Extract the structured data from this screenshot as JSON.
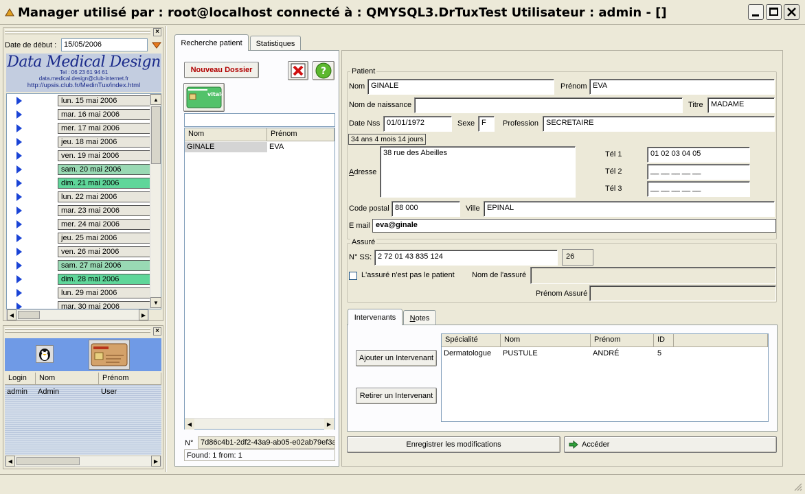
{
  "window": {
    "title": "Manager utilisé par : root@localhost connecté à : QMYSQL3.DrTuxTest Utilisateur : admin - []"
  },
  "agenda": {
    "start_label": "Date de début :",
    "start_date": "15/05/2006",
    "logo_title": "Data Medical Design",
    "logo_tel": "Tel : 06 23 61 94 61",
    "logo_email": "data.medical.design@club-internet.fr",
    "logo_url": "http://upsis.club.fr/MedinTux/index.html",
    "days": [
      {
        "label": "lun. 15 mai 2006",
        "style": "normal"
      },
      {
        "label": "mar. 16 mai 2006",
        "style": "normal"
      },
      {
        "label": "mer. 17 mai 2006",
        "style": "normal"
      },
      {
        "label": "jeu. 18 mai 2006",
        "style": "normal"
      },
      {
        "label": "ven. 19 mai 2006",
        "style": "normal"
      },
      {
        "label": "sam. 20 mai 2006",
        "style": "lightgreen"
      },
      {
        "label": "dim. 21 mai 2006",
        "style": "green"
      },
      {
        "label": "lun. 22 mai 2006",
        "style": "normal"
      },
      {
        "label": "mar. 23 mai 2006",
        "style": "normal"
      },
      {
        "label": "mer. 24 mai 2006",
        "style": "normal"
      },
      {
        "label": "jeu. 25 mai 2006",
        "style": "normal"
      },
      {
        "label": "ven. 26 mai 2006",
        "style": "normal"
      },
      {
        "label": "sam. 27 mai 2006",
        "style": "lightgreen"
      },
      {
        "label": "dim. 28 mai 2006",
        "style": "green"
      },
      {
        "label": "lun. 29 mai 2006",
        "style": "normal"
      },
      {
        "label": "mar. 30 mai 2006",
        "style": "normal"
      }
    ]
  },
  "users": {
    "headers": [
      "Login",
      "Nom",
      "Prénom"
    ],
    "rows": [
      [
        "admin",
        "Admin",
        "User"
      ]
    ]
  },
  "search": {
    "tabs": [
      "Recherche patient",
      "Statistiques"
    ],
    "new_file": "Nouveau Dossier",
    "list_headers": [
      "Nom",
      "Prénom"
    ],
    "rows": [
      [
        "GINALE",
        "EVA"
      ]
    ],
    "id_label": "N°",
    "id_value": "7d86c4b1-2df2-43a9-ab05-e02ab79ef3a",
    "found": "Found: 1 from: 1"
  },
  "patient": {
    "group": "Patient",
    "nom_label": "Nom",
    "nom": "GINALE",
    "prenom_label": "Prénom",
    "prenom": "EVA",
    "naissance_label": "Nom de naissance",
    "naissance": "",
    "titre_label": "Titre",
    "titre": "MADAME",
    "dnss_label": "Date Nss",
    "dnss": "01/01/1972",
    "sexe_label": "Sexe",
    "sexe": "F",
    "profession_label": "Profession",
    "profession": "SECRETAIRE",
    "age": "34 ans 4 mois 14 jours",
    "adresse_label": "Adresse",
    "adresse": "38 rue des Abeilles",
    "tel1_label": "Tél 1",
    "tel1": "01  02  03 04 05",
    "tel2_label": "Tél 2",
    "tel2": "__  __  __ __ __",
    "tel3_label": "Tél 3",
    "tel3": "__  __  __ __ __",
    "cp_label": "Code postal",
    "cp": "88  000",
    "ville_label": "Ville",
    "ville": "EPINAL",
    "email_label": "E mail",
    "email": "eva@ginale"
  },
  "assure": {
    "group": "Assuré",
    "ss_label": "N° SS:",
    "ss": "2  72  01  43  835  124",
    "ss_key": "26",
    "not_patient": "L'assuré n'est pas le patient",
    "nom_label": "Nom  de l'assuré",
    "prenom_label": "Prénom Assuré"
  },
  "intervenants": {
    "tabs": [
      "Intervenants",
      "Notes"
    ],
    "add": "Ajouter un Intervenant",
    "remove": "Retirer un Intervenant",
    "headers": [
      "Spécialité",
      "Nom",
      "Prénom",
      "ID"
    ],
    "rows": [
      [
        "Dermatologue",
        "PUSTULE",
        "ANDRÉ",
        "5"
      ]
    ]
  },
  "actions": {
    "save": "Enregistrer les modifications",
    "access": "Accéder"
  }
}
